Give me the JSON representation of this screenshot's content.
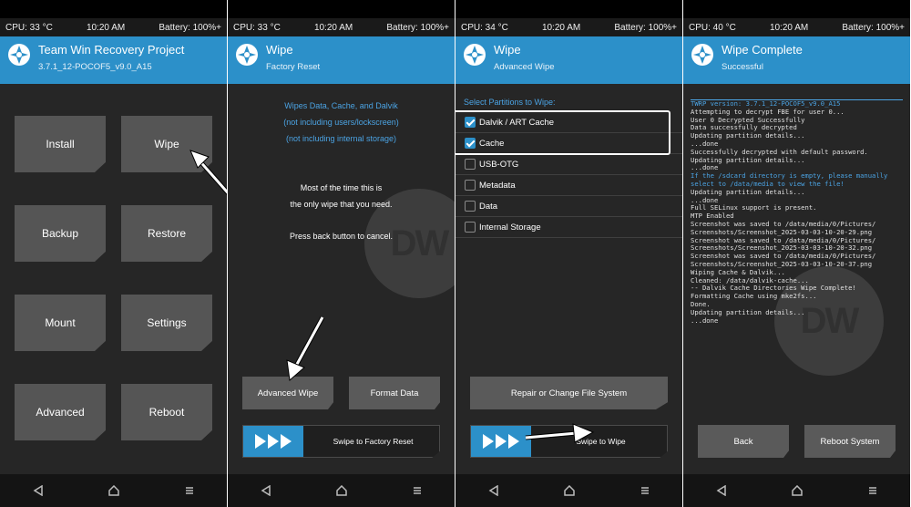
{
  "status": {
    "cpu_p1": "CPU: 33 °C",
    "cpu_p2": "CPU: 33 °C",
    "cpu_p3": "CPU: 34 °C",
    "cpu_p4": "CPU: 40 °C",
    "time": "10:20 AM",
    "battery": "Battery: 100%+"
  },
  "p1": {
    "title": "Team Win Recovery Project",
    "subtitle": "3.7.1_12-POCOF5_v9.0_A15",
    "buttons": [
      "Install",
      "Wipe",
      "Backup",
      "Restore",
      "Mount",
      "Settings",
      "Advanced",
      "Reboot"
    ]
  },
  "p2": {
    "title": "Wipe",
    "subtitle": "Factory Reset",
    "info": [
      "Wipes Data, Cache, and Dalvik",
      "(not including users/lockscreen)",
      "(not including internal storage)"
    ],
    "note": [
      "Most of the time this is",
      "the only wipe that you need."
    ],
    "back_note": "Press back button to cancel.",
    "advanced_wipe": "Advanced Wipe",
    "format_data": "Format Data",
    "swipe_label": "Swipe to Factory Reset"
  },
  "p3": {
    "title": "Wipe",
    "subtitle": "Advanced Wipe",
    "select_label": "Select Partitions to Wipe:",
    "partitions": [
      {
        "label": "Dalvik / ART Cache",
        "checked": true
      },
      {
        "label": "Cache",
        "checked": true
      },
      {
        "label": "USB-OTG",
        "checked": false
      },
      {
        "label": "Metadata",
        "checked": false
      },
      {
        "label": "Data",
        "checked": false
      },
      {
        "label": "Internal Storage",
        "checked": false
      }
    ],
    "repair_button": "Repair or Change File System",
    "swipe_label": "Swipe to Wipe"
  },
  "p4": {
    "title": "Wipe Complete",
    "subtitle": "Successful",
    "log": [
      {
        "t": "TWRP version: 3.7.1_12-POCOF5_v9.0_A15",
        "c": "b"
      },
      {
        "t": "Attempting to decrypt FBE for user 0...",
        "c": ""
      },
      {
        "t": "User 0 Decrypted Successfully",
        "c": ""
      },
      {
        "t": "Data successfully decrypted",
        "c": ""
      },
      {
        "t": "Updating partition details...",
        "c": ""
      },
      {
        "t": "...done",
        "c": ""
      },
      {
        "t": "Successfully decrypted with default password.",
        "c": ""
      },
      {
        "t": "Updating partition details...",
        "c": ""
      },
      {
        "t": "...done",
        "c": ""
      },
      {
        "t": "If the /sdcard directory is empty, please manually",
        "c": "b"
      },
      {
        "t": "select to /data/media to view the file!",
        "c": "b"
      },
      {
        "t": "Updating partition details...",
        "c": ""
      },
      {
        "t": "...done",
        "c": ""
      },
      {
        "t": "Full SELinux support is present.",
        "c": ""
      },
      {
        "t": "MTP Enabled",
        "c": ""
      },
      {
        "t": "Screenshot was saved to /data/media/0/Pictures/",
        "c": ""
      },
      {
        "t": "Screenshots/Screenshot_2025-03-03-10-20-29.png",
        "c": ""
      },
      {
        "t": "Screenshot was saved to /data/media/0/Pictures/",
        "c": ""
      },
      {
        "t": "Screenshots/Screenshot_2025-03-03-10-20-32.png",
        "c": ""
      },
      {
        "t": "Screenshot was saved to /data/media/0/Pictures/",
        "c": ""
      },
      {
        "t": "Screenshots/Screenshot_2025-03-03-10-20-37.png",
        "c": ""
      },
      {
        "t": "Wiping Cache & Dalvik...",
        "c": ""
      },
      {
        "t": "Cleaned: /data/dalvik-cache...",
        "c": ""
      },
      {
        "t": "-- Dalvik Cache Directories Wipe Complete!",
        "c": ""
      },
      {
        "t": "Formatting Cache using mke2fs...",
        "c": ""
      },
      {
        "t": "Done.",
        "c": ""
      },
      {
        "t": "Updating partition details...",
        "c": ""
      },
      {
        "t": "...done",
        "c": ""
      }
    ],
    "back_button": "Back",
    "reboot_button": "Reboot System"
  },
  "watermark": "DW",
  "colors": {
    "accent": "#2c90c9",
    "background": "#262626",
    "button": "#555555"
  },
  "nav_icons": [
    "back-triangle-icon",
    "home-icon",
    "menu-icon"
  ]
}
